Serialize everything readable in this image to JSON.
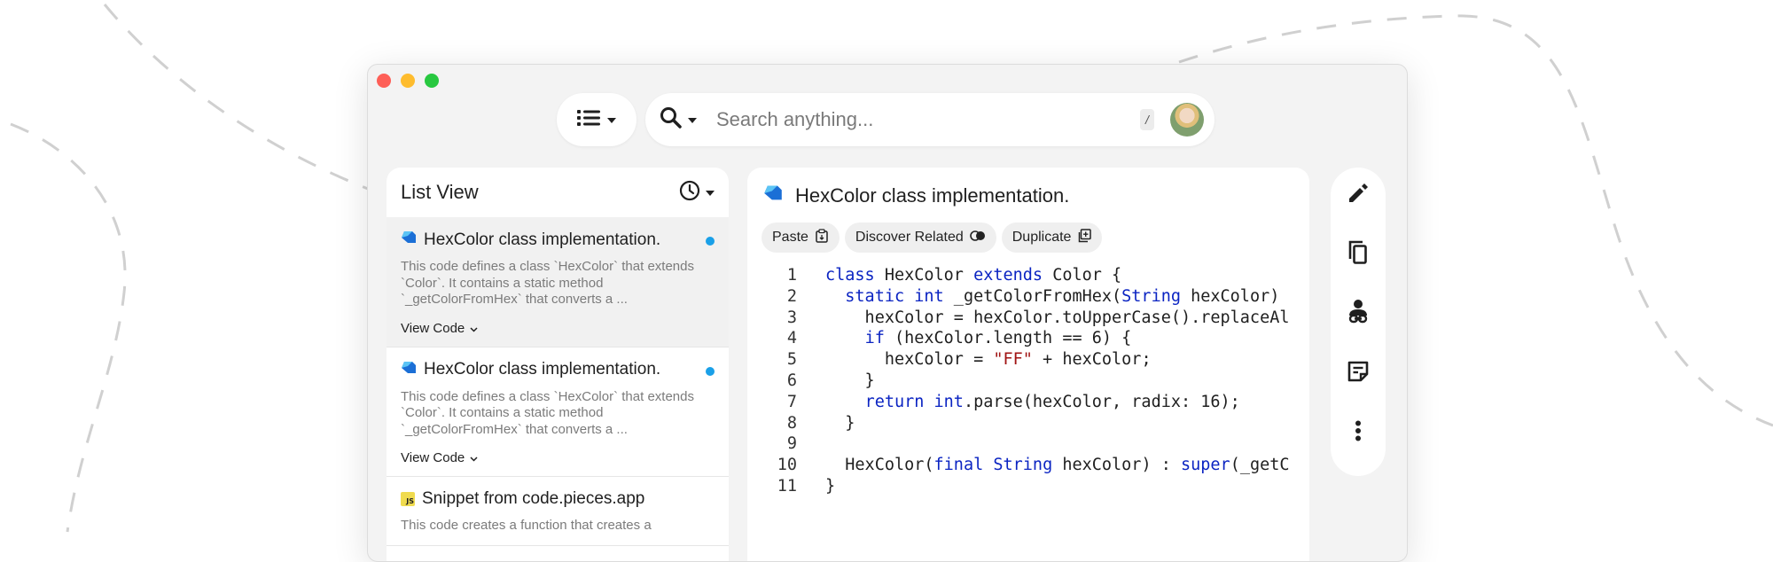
{
  "window": {
    "controls": [
      "close",
      "minimize",
      "zoom"
    ]
  },
  "toolbar": {
    "view_toggle_icon": "list-icon",
    "search": {
      "placeholder": "Search anything...",
      "shortcut": "/"
    }
  },
  "list_panel": {
    "title": "List View",
    "sort_icon": "clock-icon",
    "items": [
      {
        "icon": "dart-icon",
        "title": "HexColor class implementation.",
        "description": "This code defines a class `HexColor` that extends `Color`. It contains a static method `_getColorFromHex` that converts a ...",
        "action": "View Code",
        "unread": true,
        "selected": true
      },
      {
        "icon": "dart-icon",
        "title": "HexColor class implementation.",
        "description": "This code defines a class `HexColor` that extends `Color`. It contains a static method `_getColorFromHex` that converts a ...",
        "action": "View Code",
        "unread": true,
        "selected": false
      },
      {
        "icon": "js-icon",
        "badge": "JS",
        "title": "Snippet from code.pieces.app",
        "description": "This code creates a function that creates a"
      }
    ]
  },
  "detail": {
    "icon": "dart-icon",
    "title": "HexColor class implementation.",
    "chips": [
      {
        "label": "Paste",
        "icon": "clipboard-icon"
      },
      {
        "label": "Discover Related",
        "icon": "toggle-icon"
      },
      {
        "label": "Duplicate",
        "icon": "duplicate-icon"
      }
    ],
    "code_lines": [
      {
        "n": "1",
        "text": "class HexColor extends Color {"
      },
      {
        "n": "2",
        "text": "  static int _getColorFromHex(String hexColor)"
      },
      {
        "n": "3",
        "text": "    hexColor = hexColor.toUpperCase().replaceAl"
      },
      {
        "n": "4",
        "text": "    if (hexColor.length == 6) {"
      },
      {
        "n": "5",
        "text": "      hexColor = \"FF\" + hexColor;"
      },
      {
        "n": "6",
        "text": "    }"
      },
      {
        "n": "7",
        "text": "    return int.parse(hexColor, radix: 16);"
      },
      {
        "n": "8",
        "text": "  }"
      },
      {
        "n": "9",
        "text": ""
      },
      {
        "n": "10",
        "text": "  HexColor(final String hexColor) : super(_getC"
      },
      {
        "n": "11",
        "text": "}"
      }
    ]
  },
  "side_actions": [
    "edit-icon",
    "copy-icon",
    "share-icon",
    "notes-icon",
    "more-icon"
  ],
  "colors": {
    "keyword": "#0b24c2",
    "type": "#a11414",
    "unread": "#1aa0e8",
    "dart": "#1b6fd6"
  }
}
